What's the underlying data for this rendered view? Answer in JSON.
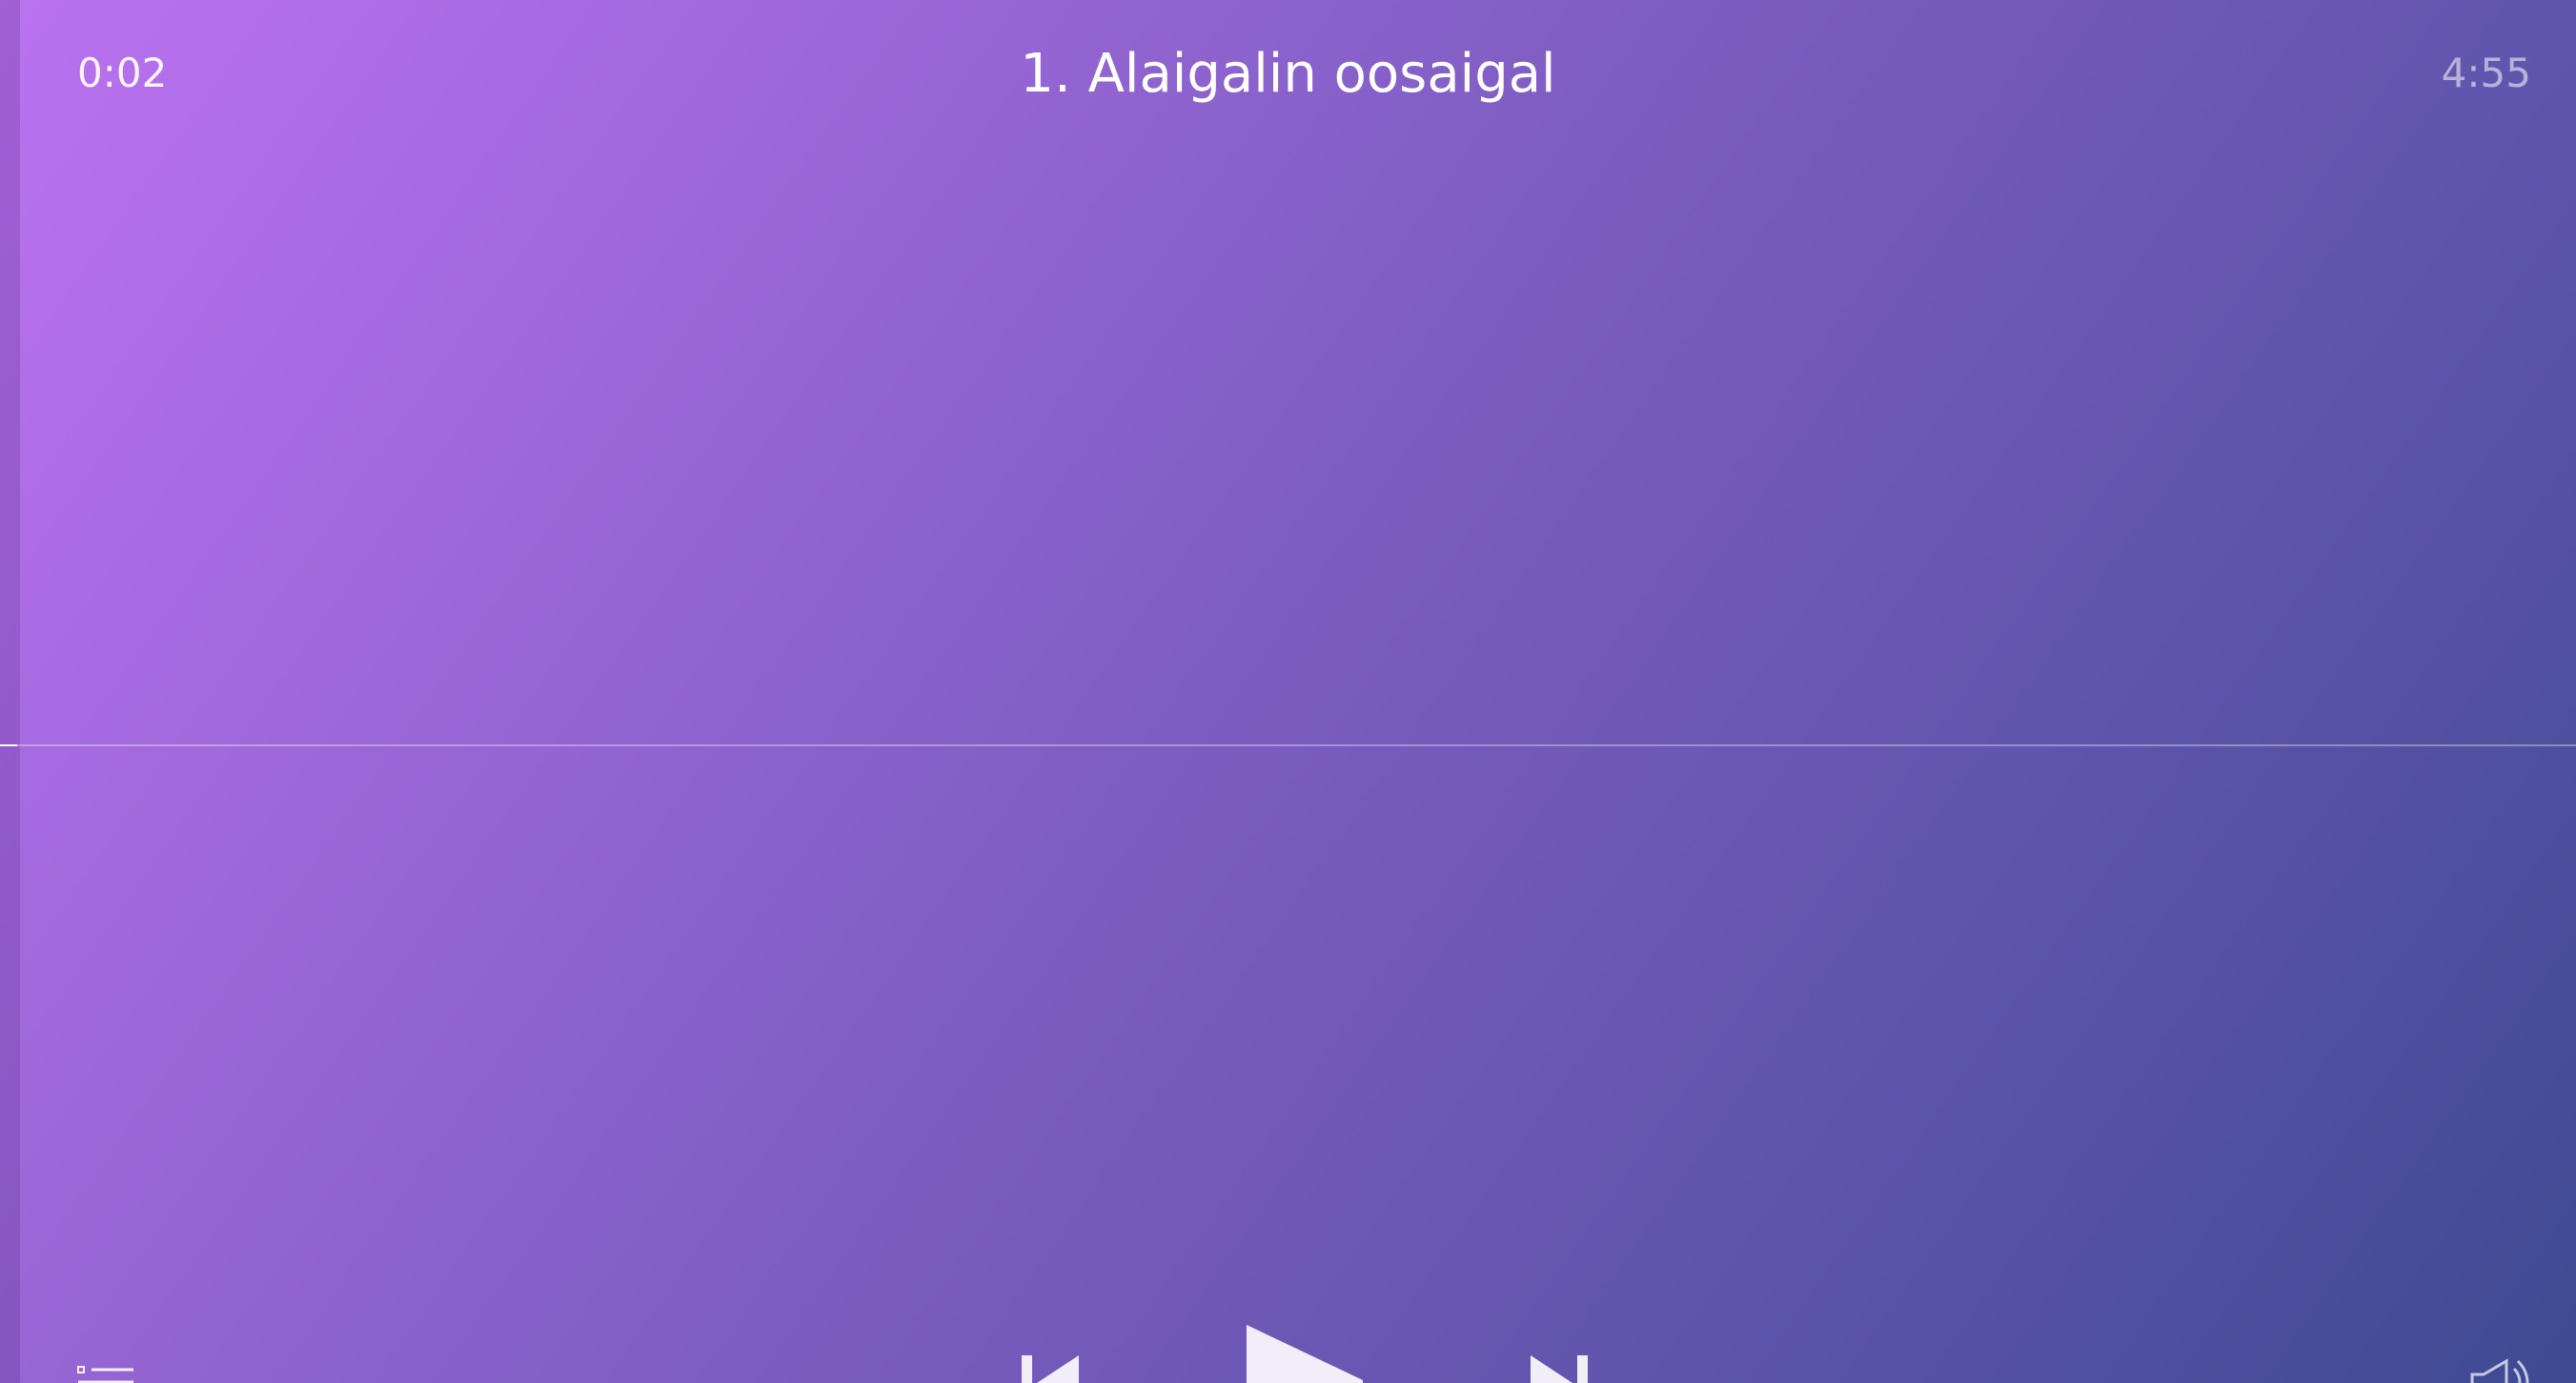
{
  "player": {
    "elapsed": "0:02",
    "duration": "4:55",
    "track_title": "1. Alaigalin oosaigal",
    "progress_fraction": 0.0068,
    "colors": {
      "gradient_start": "#bb72f0",
      "gradient_end": "#3e4a92",
      "foreground": "#ffffff"
    }
  },
  "controls": {
    "playlist_icon": "playlist-icon",
    "previous_icon": "skip-previous-icon",
    "play_icon": "play-icon",
    "next_icon": "skip-next-icon",
    "volume_icon": "volume-icon"
  }
}
